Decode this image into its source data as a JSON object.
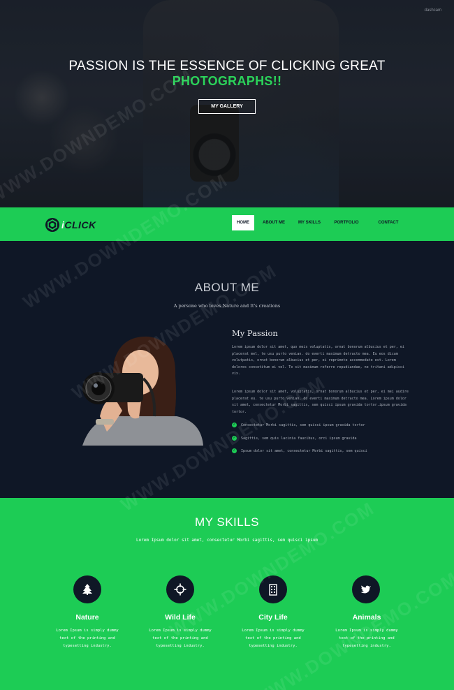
{
  "hero": {
    "corner_text": "dashcam",
    "title": "PASSION IS THE ESSENCE OF CLICKING GREAT",
    "subtitle": "PHOTOGRAPHS!!",
    "button_label": "MY GALLERY"
  },
  "navbar": {
    "logo_i": "i",
    "logo_text": "CLICK",
    "items": [
      {
        "label": "HOME",
        "active": true
      },
      {
        "label": "ABOUT ME"
      },
      {
        "label": "MY SKILLS"
      },
      {
        "label": "PORTFOLIO"
      },
      {
        "label": "CONTACT"
      }
    ]
  },
  "about": {
    "title": "ABOUT ME",
    "subtitle": "A persone who loves Nature and It's creations",
    "passion_title": "My Passion",
    "paragraph1": "Lorem ipsum dolor sit amet, quo meis voluptatis, ornat bonorum albucius et per, ei placerat mel, te usu purto venian. do everti maximum detracto mea. Eu eos dicam volutpatis, ornat bonorum albucius et per, ei reprimnte accommodate est. Lorem dolores consetitum ei vel. Te sit maximum referre repudiandae, ne tritani adipisci vix.",
    "paragraph2": "Lorem ipsum dolor sit amet, voluptatis, ornat bonorum albucius et per, ei mei audire placerat eu. te usu purto venian. do everti maximum detracto mea. Lorem ipsum dolor sit amet, consectetur Morbi sagittis, sem quisci ipsum gravida tortor.ipsum gravida tortor.",
    "checklist": [
      "Consectetur Morbi sagittis, sem quisci ipsum gravida tortor",
      "Sagittis, sem quis lacinia faucibus, orci ipsum gravida",
      "Ipsum dolor sit amet, consectetur Morbi sagittis, sem quisci"
    ]
  },
  "skills": {
    "title": "MY SKILLS",
    "subtitle": "Lorem Ipsum dolor sit amet, consectetur Morbi sagittis, sem quisci ipsum",
    "items": [
      {
        "name": "Nature",
        "icon": "tree-icon",
        "desc1": "Lorem Ipsum is simply dummy",
        "desc2": "text of the printing and",
        "desc3": "typesetting industry."
      },
      {
        "name": "Wild Life",
        "icon": "crosshair-icon",
        "desc1": "Lorem Ipsum is simply dummy",
        "desc2": "text of the printing and",
        "desc3": "typesetting industry."
      },
      {
        "name": "City Life",
        "icon": "building-icon",
        "desc1": "Lorem Ipsum is simply dummy",
        "desc2": "text of the printing and",
        "desc3": "typesetting industry."
      },
      {
        "name": "Animals",
        "icon": "bird-icon",
        "desc1": "Lorem Ipsum is simply dummy",
        "desc2": "text of the printing and",
        "desc3": "typesetting industry."
      }
    ]
  },
  "watermark": "WWW.DOWNDEMO.COM",
  "colors": {
    "accent": "#1dcc55",
    "dark": "#0f1726",
    "hero_subtitle": "#2bd35a"
  }
}
